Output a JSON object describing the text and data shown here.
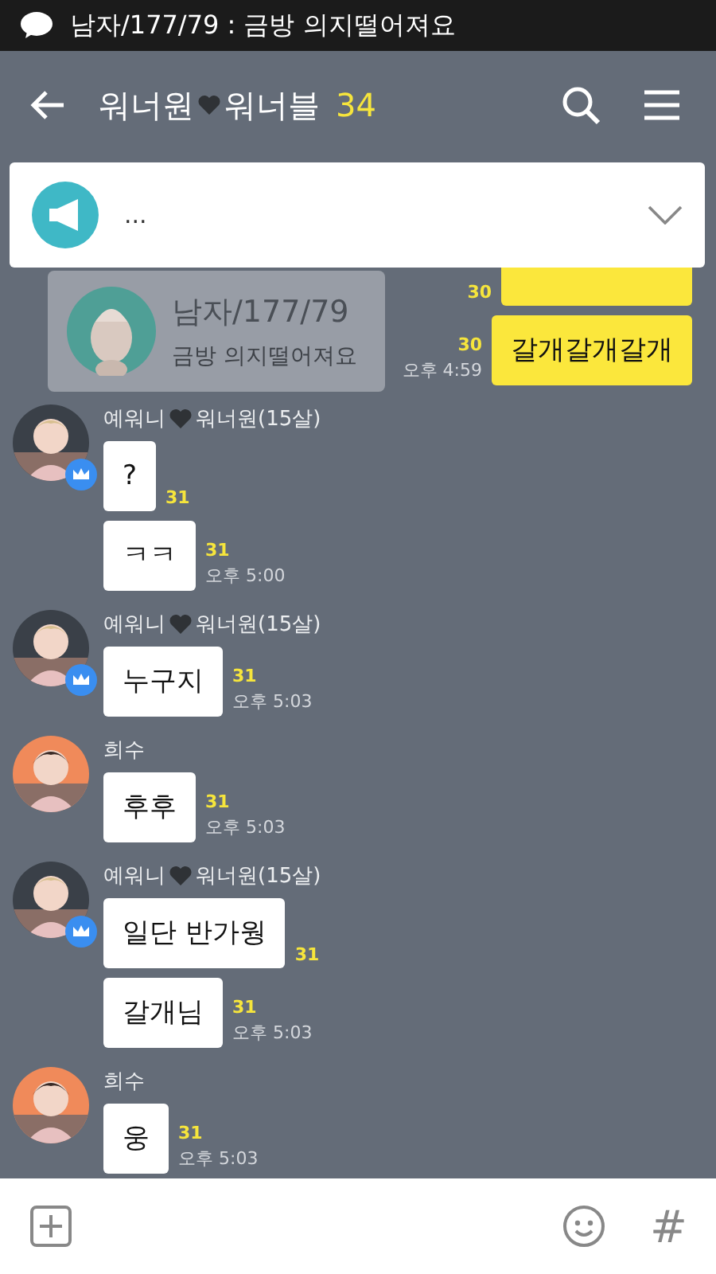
{
  "status_bar": {
    "notification": "남자/177/79 : 금방 의지떨어져요"
  },
  "header": {
    "title_parts": [
      "워너원",
      "워너블"
    ],
    "member_count": "34"
  },
  "notice": {
    "text": "..."
  },
  "popup": {
    "sender": "남자/177/79",
    "message": "금방 의지떨어져요"
  },
  "messages": [
    {
      "kind": "sent",
      "bubbles": [
        {
          "unread": "30"
        },
        {
          "text": "갈개갈개갈개",
          "unread": "30",
          "time": "오후 4:59"
        }
      ]
    },
    {
      "kind": "received",
      "sender_parts": [
        "예워니",
        "워너원(15살)"
      ],
      "host": true,
      "bubbles": [
        {
          "text": "?",
          "unread": "31"
        },
        {
          "text": "ㅋㅋ",
          "unread": "31",
          "time": "오후 5:00"
        }
      ]
    },
    {
      "kind": "received",
      "sender_parts": [
        "예워니",
        "워너원(15살)"
      ],
      "host": true,
      "bubbles": [
        {
          "text": "누구지",
          "unread": "31",
          "time": "오후 5:03"
        }
      ]
    },
    {
      "kind": "received",
      "sender_parts": [
        "희수"
      ],
      "host": false,
      "bubbles": [
        {
          "text": "후후",
          "unread": "31",
          "time": "오후 5:03"
        }
      ]
    },
    {
      "kind": "received",
      "sender_parts": [
        "예워니",
        "워너원(15살)"
      ],
      "host": true,
      "bubbles": [
        {
          "text": "일단 반가웡",
          "unread": "31"
        },
        {
          "text": "갈개님",
          "unread": "31",
          "time": "오후 5:03"
        }
      ]
    },
    {
      "kind": "received",
      "sender_parts": [
        "희수"
      ],
      "host": false,
      "bubbles": [
        {
          "text": "웅",
          "unread": "31",
          "time": "오후 5:03"
        }
      ]
    }
  ],
  "input_bar": {
    "hashtag": "#"
  }
}
